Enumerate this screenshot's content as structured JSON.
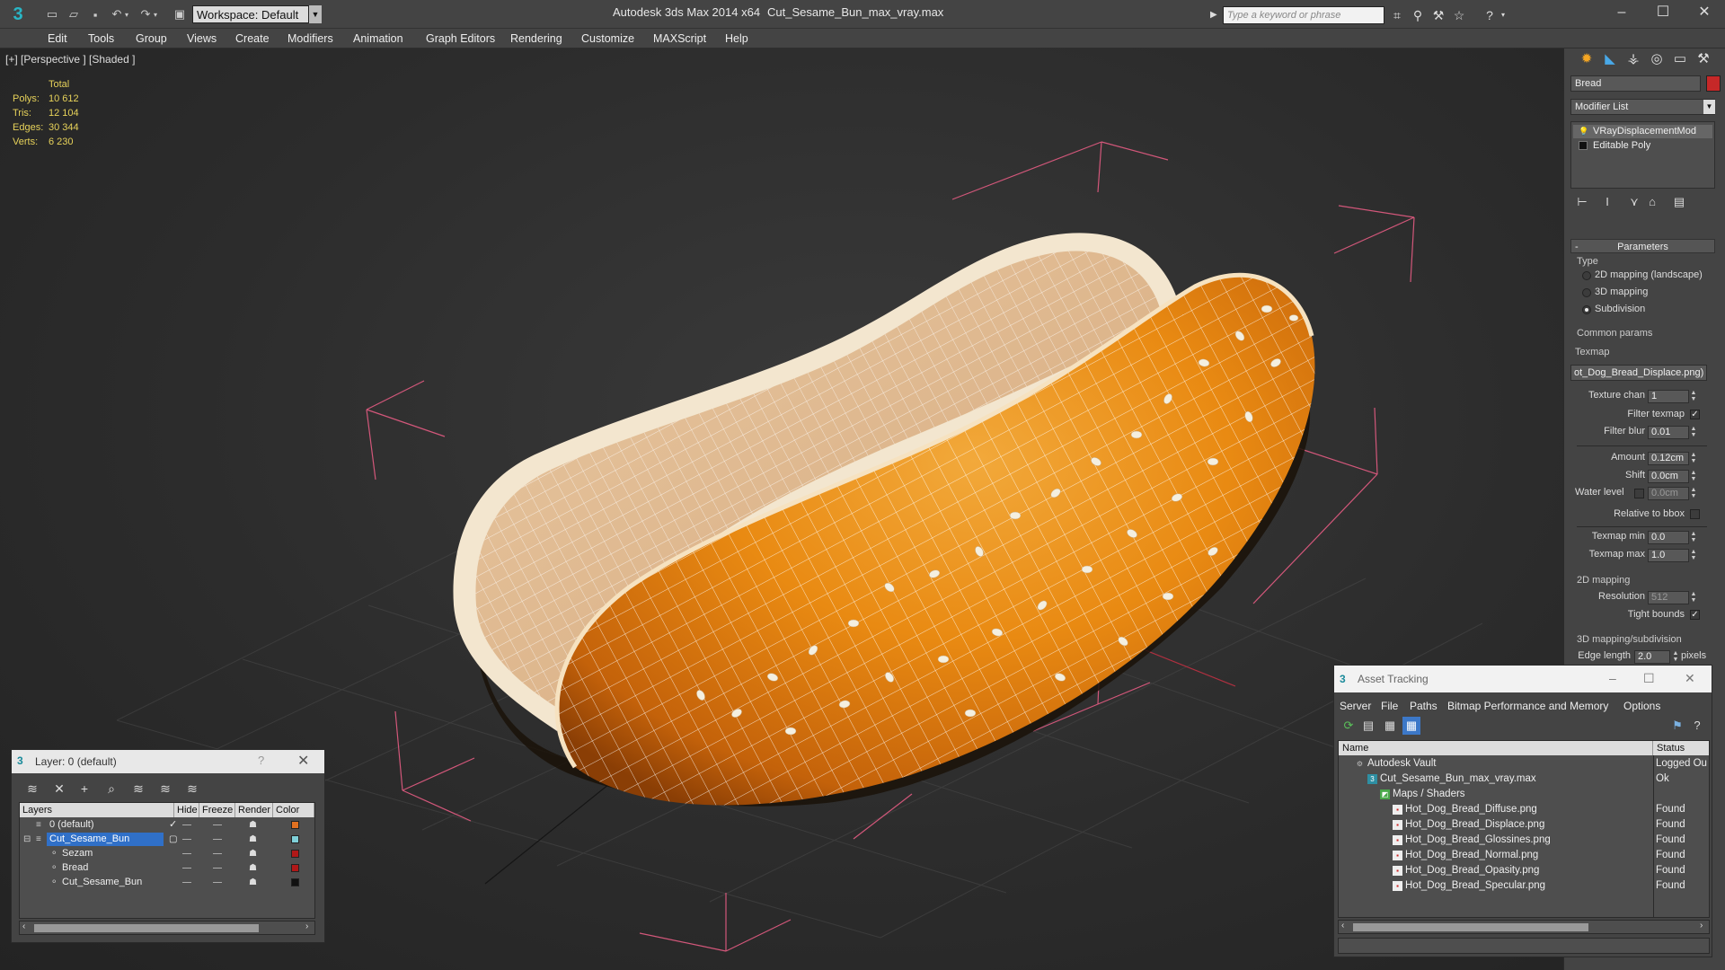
{
  "title_bar": {
    "app_title": "Autodesk 3ds Max  2014 x64",
    "file_title": "Cut_Sesame_Bun_max_vray.max",
    "workspace": "Workspace: Default",
    "search_placeholder": "Type a keyword or phrase"
  },
  "menu": [
    "Edit",
    "Tools",
    "Group",
    "Views",
    "Create",
    "Modifiers",
    "Animation",
    "Graph Editors",
    "Rendering",
    "Customize",
    "MAXScript",
    "Help"
  ],
  "viewport": {
    "label": "[+] [Perspective ] [Shaded ]",
    "stats_header": "Total",
    "stats": [
      {
        "label": "Polys:",
        "value": "10 612"
      },
      {
        "label": "Tris:",
        "value": "12 104"
      },
      {
        "label": "Edges:",
        "value": "30 344"
      },
      {
        "label": "Verts:",
        "value": "6 230"
      }
    ]
  },
  "command_panel": {
    "object_name": "Bread",
    "object_color": "#c62828",
    "modifier_list": "Modifier List",
    "stack": [
      "VRayDisplacementMod",
      "Editable Poly"
    ],
    "parameters": {
      "header": "Parameters",
      "type_label": "Type",
      "type_options": [
        "2D mapping (landscape)",
        "3D mapping",
        "Subdivision"
      ],
      "type_selected": 2,
      "common_label": "Common params",
      "texmap_label": "Texmap",
      "texmap_value": "ot_Dog_Bread_Displace.png)",
      "texture_chan_label": "Texture chan",
      "texture_chan": "1",
      "filter_texmap_label": "Filter texmap",
      "filter_texmap": true,
      "filter_blur_label": "Filter blur",
      "filter_blur": "0.01",
      "amount_label": "Amount",
      "amount": "0.12cm",
      "shift_label": "Shift",
      "shift": "0.0cm",
      "water_level_label": "Water level",
      "water_level": "0.0cm",
      "relative_bbox_label": "Relative to bbox",
      "texmap_min_label": "Texmap min",
      "texmap_min": "0.0",
      "texmap_max_label": "Texmap max",
      "texmap_max": "1.0",
      "mapping2d_label": "2D mapping",
      "resolution_label": "Resolution",
      "resolution": "512",
      "tight_bounds_label": "Tight bounds",
      "mapping3d_label": "3D mapping/subdivision",
      "edge_length_label": "Edge length",
      "edge_length": "2.0",
      "pixels_label": "pixels"
    }
  },
  "layer_dialog": {
    "title": "Layer: 0 (default)",
    "help": "?",
    "columns": [
      "Layers",
      "Hide",
      "Freeze",
      "Render",
      "Color"
    ],
    "rows": [
      {
        "name": "0 (default)",
        "color": "#e07020"
      },
      {
        "name": "Cut_Sesame_Bun",
        "color": "#7fd0d8"
      },
      {
        "name": "Sezam",
        "color": "#b01818"
      },
      {
        "name": "Bread",
        "color": "#b01818"
      },
      {
        "name": "Cut_Sesame_Bun",
        "color": "#111111"
      }
    ]
  },
  "asset_dialog": {
    "title": "Asset Tracking",
    "menu": [
      "Server",
      "File",
      "Paths",
      "Bitmap Performance and Memory",
      "Options"
    ],
    "columns": [
      "Name",
      "Status"
    ],
    "rows": [
      {
        "name": "Autodesk Vault",
        "status": "Logged Ou"
      },
      {
        "name": "Cut_Sesame_Bun_max_vray.max",
        "status": "Ok"
      },
      {
        "name": "Maps / Shaders",
        "status": ""
      },
      {
        "name": "Hot_Dog_Bread_Diffuse.png",
        "status": "Found"
      },
      {
        "name": "Hot_Dog_Bread_Displace.png",
        "status": "Found"
      },
      {
        "name": "Hot_Dog_Bread_Glossines.png",
        "status": "Found"
      },
      {
        "name": "Hot_Dog_Bread_Normal.png",
        "status": "Found"
      },
      {
        "name": "Hot_Dog_Bread_Opasity.png",
        "status": "Found"
      },
      {
        "name": "Hot_Dog_Bread_Specular.png",
        "status": "Found"
      }
    ]
  }
}
